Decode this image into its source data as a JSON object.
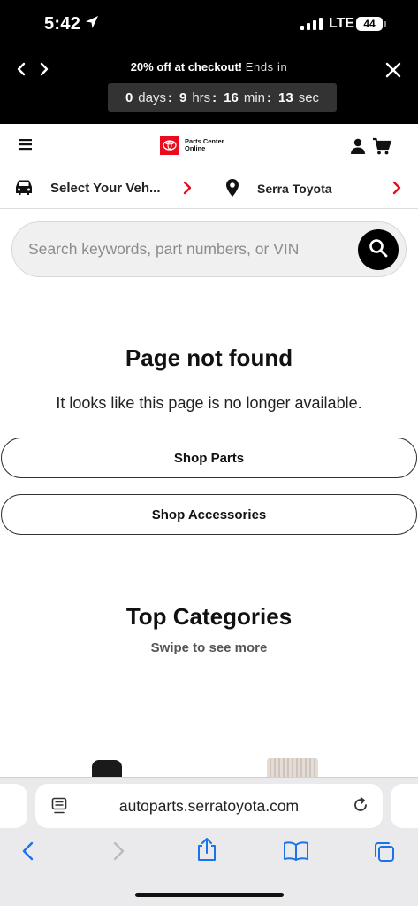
{
  "status_bar": {
    "time": "5:42",
    "network": "LTE",
    "battery": "44"
  },
  "promo": {
    "headline": "20% off at checkout!",
    "ends_text": "Ends in",
    "countdown": {
      "days": "0",
      "days_label": "days",
      "hours": "9",
      "hours_label": "hrs",
      "minutes": "16",
      "minutes_label": "min",
      "seconds": "13",
      "seconds_label": "sec"
    }
  },
  "header": {
    "logo_line1": "Parts Center",
    "logo_line2": "Online",
    "brand_color": "#eb0a1e"
  },
  "selectors": {
    "vehicle_label": "Select Your Veh...",
    "dealer_label": "Serra Toyota",
    "chevron_color": "#eb0a1e"
  },
  "search": {
    "placeholder": "Search keywords, part numbers, or VIN",
    "value": ""
  },
  "main": {
    "title": "Page not found",
    "message": "It looks like this page is no longer available.",
    "shop_parts_label": "Shop Parts",
    "shop_accessories_label": "Shop Accessories",
    "categories_title": "Top Categories",
    "categories_subtitle": "Swipe to see more"
  },
  "browser": {
    "url": "autoparts.serratoyota.com",
    "accent_color": "#1a73e8"
  },
  "icons": {
    "status": [
      "location-arrow-icon",
      "signal-icon",
      "battery-icon"
    ],
    "promo": [
      "chevron-left-icon",
      "chevron-right-icon",
      "close-icon"
    ],
    "header": [
      "hamburger-menu-icon",
      "toyota-logo-icon",
      "account-icon",
      "cart-icon"
    ],
    "selectors": [
      "car-icon",
      "location-pin-icon",
      "chevron-right-icon"
    ],
    "search": [
      "search-icon"
    ],
    "browser": [
      "page-menu-icon",
      "reload-icon",
      "back-icon",
      "forward-icon",
      "share-icon",
      "bookmarks-icon",
      "tabs-icon"
    ]
  }
}
